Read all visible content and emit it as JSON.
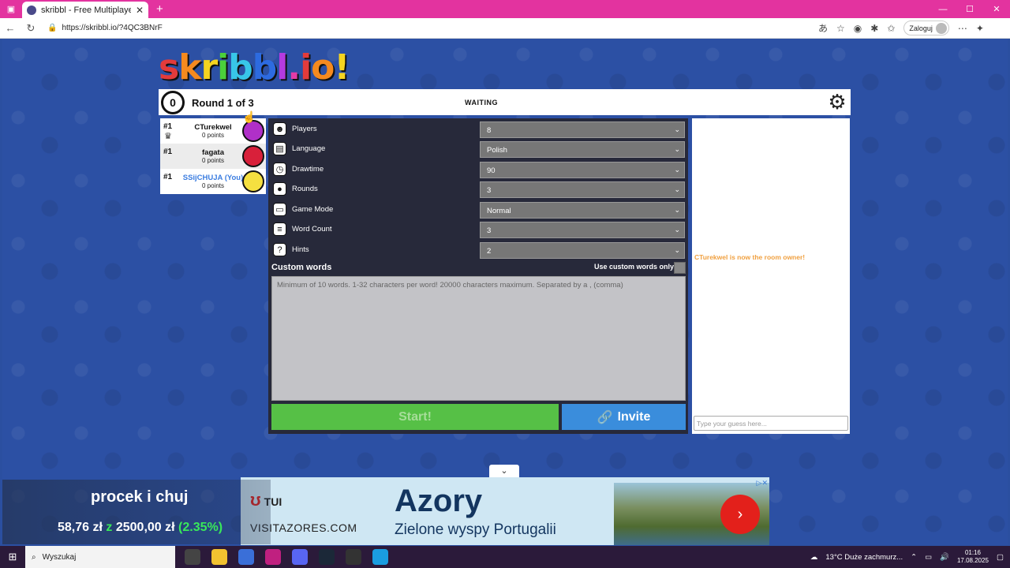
{
  "browser": {
    "tab_title": "skribbl - Free Multiplayer Drawing",
    "new_tab": "+",
    "url": "https://skribbl.io/?4QC3BNrF",
    "login_label": "Zaloguj"
  },
  "game": {
    "logo": [
      "s",
      "k",
      "r",
      "i",
      "b",
      "b",
      "l",
      ".",
      "i",
      "o",
      "!"
    ],
    "clock_value": "0",
    "round_text": "Round 1 of 3",
    "status": "WAITING",
    "players": [
      {
        "rank": "#1",
        "name": "CTurekwel",
        "points": "0 points",
        "avatar_color": "#b030c8",
        "is_owner": true,
        "is_you": false
      },
      {
        "rank": "#1",
        "name": "fagata",
        "points": "0 points",
        "avatar_color": "#d8203a",
        "is_owner": false,
        "is_you": false
      },
      {
        "rank": "#1",
        "name": "SSijCHUJA (You)",
        "points": "0 points",
        "avatar_color": "#f5e040",
        "is_owner": false,
        "is_you": true
      }
    ],
    "settings": [
      {
        "label": "Players",
        "value": "8",
        "icon": "person-icon"
      },
      {
        "label": "Language",
        "value": "Polish",
        "icon": "book-icon"
      },
      {
        "label": "Drawtime",
        "value": "90",
        "icon": "clock-icon"
      },
      {
        "label": "Rounds",
        "value": "3",
        "icon": "blob-icon"
      },
      {
        "label": "Game Mode",
        "value": "Normal",
        "icon": "controller-icon"
      },
      {
        "label": "Word Count",
        "value": "3",
        "icon": "word-icon"
      },
      {
        "label": "Hints",
        "value": "2",
        "icon": "question-icon"
      }
    ],
    "custom_words_label": "Custom words",
    "custom_only_label": "Use custom words only",
    "custom_placeholder": "Minimum of 10 words. 1-32 characters per word! 20000 characters maximum. Separated by a , (comma)",
    "start_label": "Start!",
    "invite_label": "Invite",
    "chat_message": "CTurekwel is now the room owner!",
    "chat_placeholder": "Type your guess here..."
  },
  "ad": {
    "brand": "TUI",
    "site": "VISITAZORES.COM",
    "headline": "Azory",
    "subline": "Zielone wyspy Portugalii"
  },
  "overlay": {
    "line1": "procek i chuj",
    "amount": "58,76 zł",
    "of": "z",
    "goal": "2500,00 zł",
    "percent": "(2.35%)"
  },
  "taskbar": {
    "search": "Wyszukaj",
    "weather": "13°C  Duże zachmurz...",
    "time": "01:16",
    "date": "17.08.2025"
  },
  "colors": {
    "tab_bar": "#e3339f",
    "page_bg": "#2c50a4",
    "start_green": "#56c046",
    "invite_blue": "#3a8ddc",
    "chat_owner": "#f0a040"
  }
}
